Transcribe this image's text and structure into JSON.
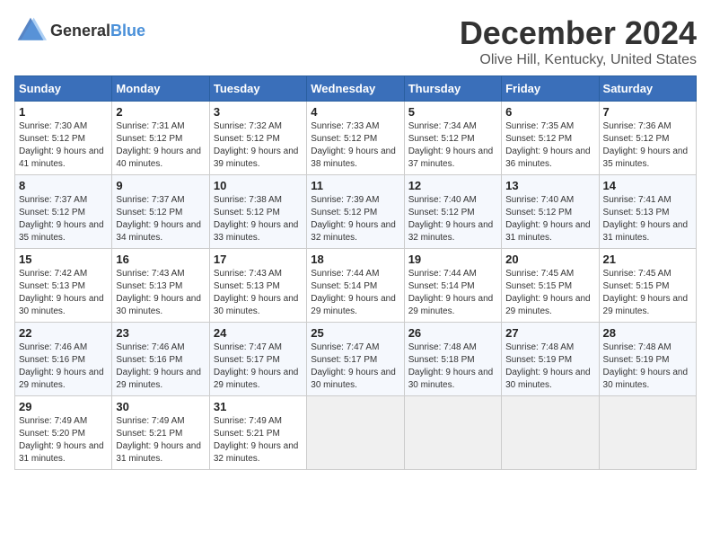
{
  "logo": {
    "text_general": "General",
    "text_blue": "Blue"
  },
  "header": {
    "month_year": "December 2024",
    "location": "Olive Hill, Kentucky, United States"
  },
  "days_of_week": [
    "Sunday",
    "Monday",
    "Tuesday",
    "Wednesday",
    "Thursday",
    "Friday",
    "Saturday"
  ],
  "weeks": [
    [
      {
        "day": "1",
        "sunrise": "Sunrise: 7:30 AM",
        "sunset": "Sunset: 5:12 PM",
        "daylight": "Daylight: 9 hours and 41 minutes."
      },
      {
        "day": "2",
        "sunrise": "Sunrise: 7:31 AM",
        "sunset": "Sunset: 5:12 PM",
        "daylight": "Daylight: 9 hours and 40 minutes."
      },
      {
        "day": "3",
        "sunrise": "Sunrise: 7:32 AM",
        "sunset": "Sunset: 5:12 PM",
        "daylight": "Daylight: 9 hours and 39 minutes."
      },
      {
        "day": "4",
        "sunrise": "Sunrise: 7:33 AM",
        "sunset": "Sunset: 5:12 PM",
        "daylight": "Daylight: 9 hours and 38 minutes."
      },
      {
        "day": "5",
        "sunrise": "Sunrise: 7:34 AM",
        "sunset": "Sunset: 5:12 PM",
        "daylight": "Daylight: 9 hours and 37 minutes."
      },
      {
        "day": "6",
        "sunrise": "Sunrise: 7:35 AM",
        "sunset": "Sunset: 5:12 PM",
        "daylight": "Daylight: 9 hours and 36 minutes."
      },
      {
        "day": "7",
        "sunrise": "Sunrise: 7:36 AM",
        "sunset": "Sunset: 5:12 PM",
        "daylight": "Daylight: 9 hours and 35 minutes."
      }
    ],
    [
      {
        "day": "8",
        "sunrise": "Sunrise: 7:37 AM",
        "sunset": "Sunset: 5:12 PM",
        "daylight": "Daylight: 9 hours and 35 minutes."
      },
      {
        "day": "9",
        "sunrise": "Sunrise: 7:37 AM",
        "sunset": "Sunset: 5:12 PM",
        "daylight": "Daylight: 9 hours and 34 minutes."
      },
      {
        "day": "10",
        "sunrise": "Sunrise: 7:38 AM",
        "sunset": "Sunset: 5:12 PM",
        "daylight": "Daylight: 9 hours and 33 minutes."
      },
      {
        "day": "11",
        "sunrise": "Sunrise: 7:39 AM",
        "sunset": "Sunset: 5:12 PM",
        "daylight": "Daylight: 9 hours and 32 minutes."
      },
      {
        "day": "12",
        "sunrise": "Sunrise: 7:40 AM",
        "sunset": "Sunset: 5:12 PM",
        "daylight": "Daylight: 9 hours and 32 minutes."
      },
      {
        "day": "13",
        "sunrise": "Sunrise: 7:40 AM",
        "sunset": "Sunset: 5:12 PM",
        "daylight": "Daylight: 9 hours and 31 minutes."
      },
      {
        "day": "14",
        "sunrise": "Sunrise: 7:41 AM",
        "sunset": "Sunset: 5:13 PM",
        "daylight": "Daylight: 9 hours and 31 minutes."
      }
    ],
    [
      {
        "day": "15",
        "sunrise": "Sunrise: 7:42 AM",
        "sunset": "Sunset: 5:13 PM",
        "daylight": "Daylight: 9 hours and 30 minutes."
      },
      {
        "day": "16",
        "sunrise": "Sunrise: 7:43 AM",
        "sunset": "Sunset: 5:13 PM",
        "daylight": "Daylight: 9 hours and 30 minutes."
      },
      {
        "day": "17",
        "sunrise": "Sunrise: 7:43 AM",
        "sunset": "Sunset: 5:13 PM",
        "daylight": "Daylight: 9 hours and 30 minutes."
      },
      {
        "day": "18",
        "sunrise": "Sunrise: 7:44 AM",
        "sunset": "Sunset: 5:14 PM",
        "daylight": "Daylight: 9 hours and 29 minutes."
      },
      {
        "day": "19",
        "sunrise": "Sunrise: 7:44 AM",
        "sunset": "Sunset: 5:14 PM",
        "daylight": "Daylight: 9 hours and 29 minutes."
      },
      {
        "day": "20",
        "sunrise": "Sunrise: 7:45 AM",
        "sunset": "Sunset: 5:15 PM",
        "daylight": "Daylight: 9 hours and 29 minutes."
      },
      {
        "day": "21",
        "sunrise": "Sunrise: 7:45 AM",
        "sunset": "Sunset: 5:15 PM",
        "daylight": "Daylight: 9 hours and 29 minutes."
      }
    ],
    [
      {
        "day": "22",
        "sunrise": "Sunrise: 7:46 AM",
        "sunset": "Sunset: 5:16 PM",
        "daylight": "Daylight: 9 hours and 29 minutes."
      },
      {
        "day": "23",
        "sunrise": "Sunrise: 7:46 AM",
        "sunset": "Sunset: 5:16 PM",
        "daylight": "Daylight: 9 hours and 29 minutes."
      },
      {
        "day": "24",
        "sunrise": "Sunrise: 7:47 AM",
        "sunset": "Sunset: 5:17 PM",
        "daylight": "Daylight: 9 hours and 29 minutes."
      },
      {
        "day": "25",
        "sunrise": "Sunrise: 7:47 AM",
        "sunset": "Sunset: 5:17 PM",
        "daylight": "Daylight: 9 hours and 30 minutes."
      },
      {
        "day": "26",
        "sunrise": "Sunrise: 7:48 AM",
        "sunset": "Sunset: 5:18 PM",
        "daylight": "Daylight: 9 hours and 30 minutes."
      },
      {
        "day": "27",
        "sunrise": "Sunrise: 7:48 AM",
        "sunset": "Sunset: 5:19 PM",
        "daylight": "Daylight: 9 hours and 30 minutes."
      },
      {
        "day": "28",
        "sunrise": "Sunrise: 7:48 AM",
        "sunset": "Sunset: 5:19 PM",
        "daylight": "Daylight: 9 hours and 30 minutes."
      }
    ],
    [
      {
        "day": "29",
        "sunrise": "Sunrise: 7:49 AM",
        "sunset": "Sunset: 5:20 PM",
        "daylight": "Daylight: 9 hours and 31 minutes."
      },
      {
        "day": "30",
        "sunrise": "Sunrise: 7:49 AM",
        "sunset": "Sunset: 5:21 PM",
        "daylight": "Daylight: 9 hours and 31 minutes."
      },
      {
        "day": "31",
        "sunrise": "Sunrise: 7:49 AM",
        "sunset": "Sunset: 5:21 PM",
        "daylight": "Daylight: 9 hours and 32 minutes."
      },
      null,
      null,
      null,
      null
    ]
  ]
}
